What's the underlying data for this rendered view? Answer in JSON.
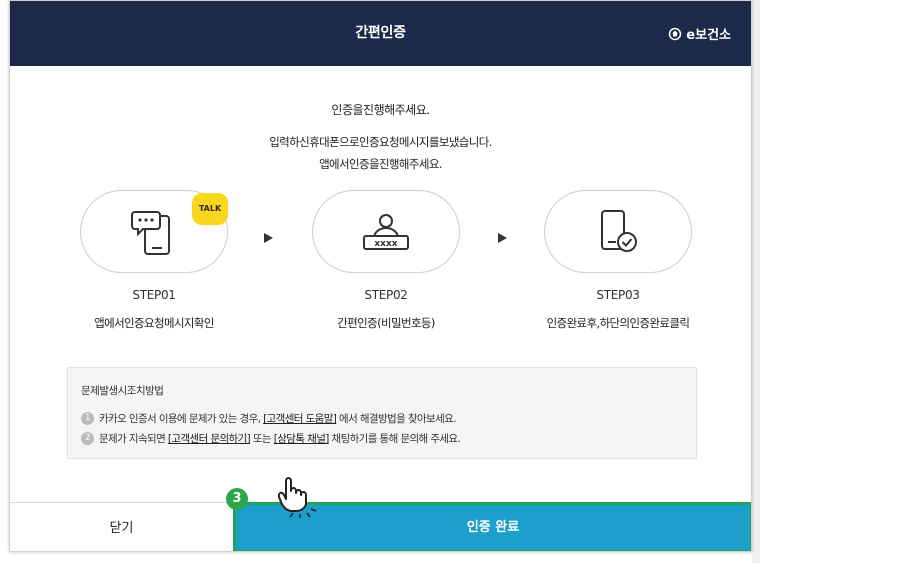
{
  "modal": {
    "title": "간편인증",
    "brand": "e보건소",
    "instruction_main": "인증을진행해주세요.",
    "instruction_sub1": "입력하신휴대폰으로인증요청메시지를보냈습니다.",
    "instruction_sub2": "앱에서인증을진행해주세요."
  },
  "badge": {
    "talk": "TALK"
  },
  "steps": [
    {
      "label": "STEP01",
      "desc": "앱에서인증요청메시지확인",
      "icon": "phone-chat-icon"
    },
    {
      "label": "STEP02",
      "desc": "간편인증(비밀번호등)",
      "icon": "user-password-icon"
    },
    {
      "label": "STEP03",
      "desc": "인증완료후,하단의인증완료클릭",
      "icon": "phone-check-icon"
    }
  ],
  "help": {
    "title": "문제발생시조치방법",
    "items": [
      {
        "num": "1",
        "pre": "카카오 인증서 이용에 문제가 있는 경우, ",
        "link1": "[고객센터 도움말]",
        "mid": " 에서 해결방법을 찾아보세요.",
        "link2": "",
        "post": ""
      },
      {
        "num": "2",
        "pre": "문제가 지속되면 ",
        "link1": "[고객센터 문의하기]",
        "mid": " 또는 ",
        "link2": "[상담톡 채널]",
        "post": " 채팅하기를 통해 문의해 주세요."
      }
    ]
  },
  "footer": {
    "close_label": "닫기",
    "done_label": "인증 완료"
  },
  "marker": {
    "number": "3"
  },
  "colors": {
    "header_bg": "#1b2a4a",
    "done_bg": "#1d9fcc",
    "highlight": "#22a45a",
    "talk_badge": "#f9d71c"
  }
}
